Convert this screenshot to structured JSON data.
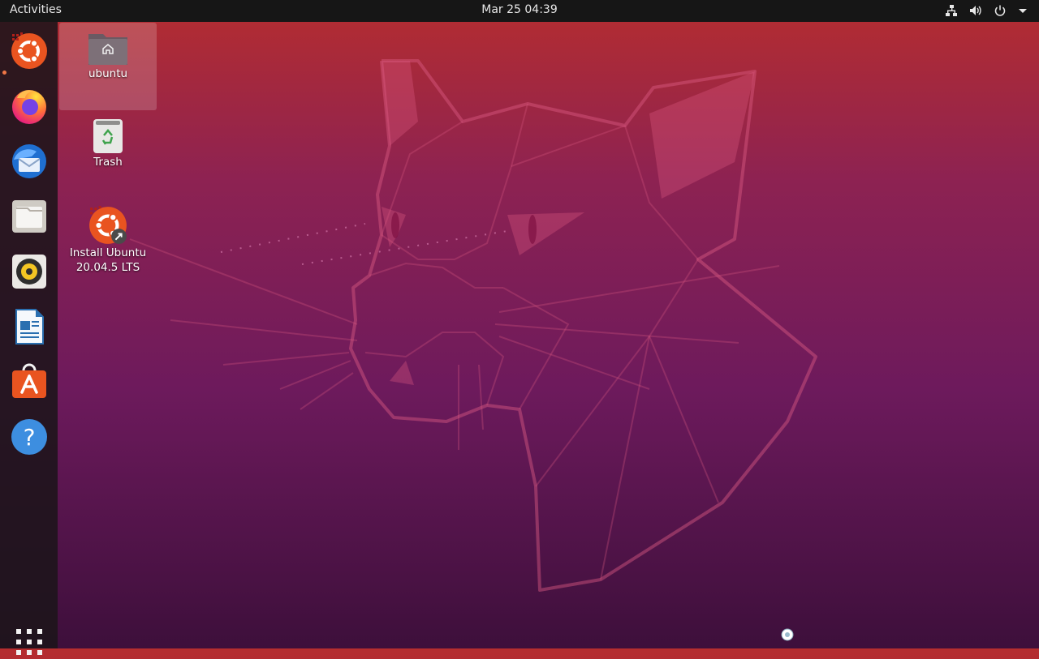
{
  "topbar": {
    "activities_label": "Activities",
    "clock": "Mar 25  04:39",
    "tray_icons": [
      "network-icon",
      "volume-icon",
      "power-icon",
      "menu-chevron-icon"
    ]
  },
  "dock": {
    "items": [
      {
        "name": "ubuntu-installer",
        "icon": "ubuntu-installer-icon",
        "running": true
      },
      {
        "name": "firefox",
        "icon": "firefox-icon"
      },
      {
        "name": "thunderbird",
        "icon": "thunderbird-icon"
      },
      {
        "name": "files",
        "icon": "files-icon"
      },
      {
        "name": "rhythmbox",
        "icon": "rhythmbox-icon"
      },
      {
        "name": "libreoffice-writer",
        "icon": "writer-icon"
      },
      {
        "name": "ubuntu-software",
        "icon": "software-icon"
      },
      {
        "name": "help",
        "icon": "help-icon"
      }
    ],
    "show_apps": "apps-grid-icon"
  },
  "desktop": {
    "icons": [
      {
        "label": "ubuntu",
        "icon": "home-folder-icon",
        "selected": true
      },
      {
        "label": "Trash",
        "icon": "trash-icon"
      },
      {
        "label": "Install Ubuntu 20.04.5 LTS",
        "icon": "install-ubuntu-icon"
      }
    ]
  },
  "colors": {
    "topbar": "#161616",
    "ubuntu_orange": "#e95420",
    "wallpaper_top": "#b52d2f",
    "wallpaper_bottom": "#3d0f3b"
  }
}
